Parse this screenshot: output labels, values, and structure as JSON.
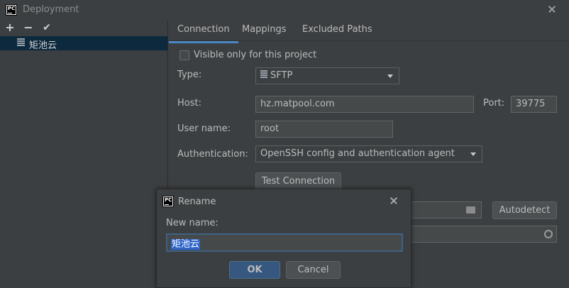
{
  "window": {
    "title": "Deployment",
    "icon": "pycharm-logo",
    "logo_text": "PC"
  },
  "toolbar": {
    "add_label": "+",
    "remove_label": "−",
    "apply_label": "✔"
  },
  "servers": [
    {
      "name": "矩池云",
      "icon": "sftp-server-icon"
    }
  ],
  "tabs": [
    {
      "label": "Connection",
      "active": true
    },
    {
      "label": "Mappings",
      "active": false
    },
    {
      "label": "Excluded Paths",
      "active": false
    }
  ],
  "connection": {
    "visible_only_label": "Visible only for this project",
    "type_label": "Type:",
    "type_value": "SFTP",
    "host_label": "Host:",
    "host_value": "hz.matpool.com",
    "port_label": "Port:",
    "port_value": "39775",
    "username_label": "User name:",
    "username_value": "root",
    "auth_label": "Authentication:",
    "auth_value": "OpenSSH config and authentication agent",
    "test_button": "Test Connection",
    "autodetect_button": "Autodetect"
  },
  "rename_dialog": {
    "title": "Rename",
    "new_name_label": "New name:",
    "new_name_value": "矩池云",
    "ok_button": "OK",
    "cancel_button": "Cancel"
  },
  "colors": {
    "background": "#3c3f41",
    "selection": "#0d293e",
    "tab_underline": "#4a88c7",
    "ok_button": "#365880",
    "text_selection": "#2f65ca"
  }
}
